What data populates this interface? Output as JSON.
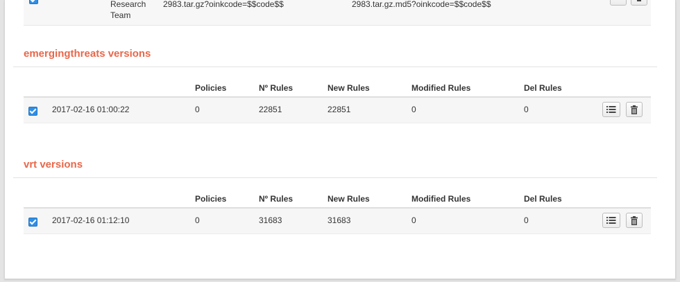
{
  "top_row": {
    "vendor_lines": [
      "Research",
      "Team"
    ],
    "url": "2983.tar.gz?oinkcode=$$code$$",
    "md5_url": "2983.tar.gz.md5?oinkcode=$$code$$"
  },
  "sections": [
    {
      "title": "emergingthreats versions",
      "headers": {
        "policies": "Policies",
        "nrules": "Nº Rules",
        "newrules": "New Rules",
        "modified": "Modified Rules",
        "del": "Del Rules"
      },
      "row": {
        "checked": true,
        "date": "2017-02-16 01:00:22",
        "policies": "0",
        "nrules": "22851",
        "newrules": "22851",
        "modified": "0",
        "del": "0"
      }
    },
    {
      "title": "vrt versions",
      "headers": {
        "policies": "Policies",
        "nrules": "Nº Rules",
        "newrules": "New Rules",
        "modified": "Modified Rules",
        "del": "Del Rules"
      },
      "row": {
        "checked": true,
        "date": "2017-02-16 01:12:10",
        "policies": "0",
        "nrules": "31683",
        "newrules": "31683",
        "modified": "0",
        "del": "0"
      }
    }
  ],
  "icons": {
    "list": "list-icon",
    "trash": "trash-icon",
    "check": "check-icon"
  },
  "colors": {
    "section_title": "#e8674a",
    "checkbox": "#2f8fe6"
  }
}
